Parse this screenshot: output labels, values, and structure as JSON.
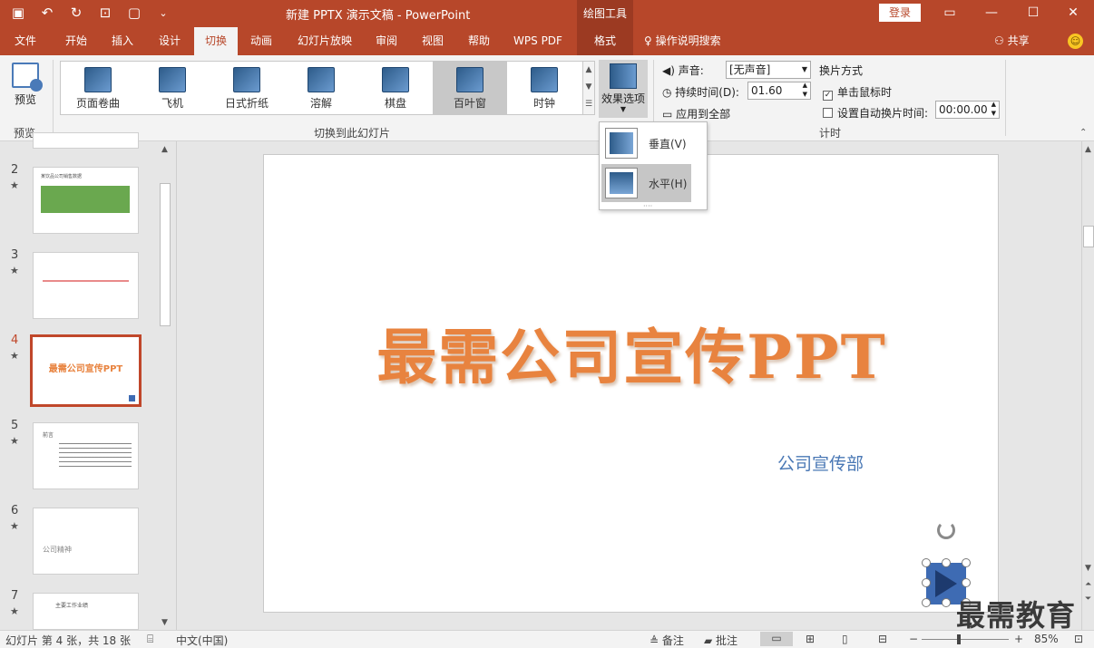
{
  "titlebar": {
    "title": "新建 PPTX 演示文稿  -  PowerPoint",
    "context_title": "绘图工具",
    "login": "登录"
  },
  "tabs": [
    "文件",
    "开始",
    "插入",
    "设计",
    "切换",
    "动画",
    "幻灯片放映",
    "审阅",
    "视图",
    "帮助",
    "WPS PDF",
    "格式"
  ],
  "tellme": "操作说明搜索",
  "share": "共享",
  "ribbon": {
    "preview_label": "预览",
    "preview_group": "预览",
    "transitions": [
      "页面卷曲",
      "飞机",
      "日式折纸",
      "溶解",
      "棋盘",
      "百叶窗",
      "时钟"
    ],
    "selected_transition": "百叶窗",
    "transitions_group": "切换到此幻灯片",
    "effect_options": "效果选项",
    "sound_label": "声音:",
    "sound_value": "[无声音]",
    "duration_label": "持续时间(D):",
    "duration_value": "01.60",
    "apply_all": "应用到全部",
    "advance_label": "换片方式",
    "on_click": "单击鼠标时",
    "after_time": "设置自动换片时间:",
    "after_time_value": "00:00.00",
    "timing_group": "计时"
  },
  "dropdown": {
    "items": [
      "垂直(V)",
      "水平(H)"
    ],
    "highlighted": "水平(H)"
  },
  "slides": [
    {
      "num": "2",
      "star": "★",
      "caption": "某饮品公司销售数据"
    },
    {
      "num": "3",
      "star": "★",
      "caption": ""
    },
    {
      "num": "4",
      "star": "★",
      "caption": "最需公司宣传PPT"
    },
    {
      "num": "5",
      "star": "★",
      "caption": "前言"
    },
    {
      "num": "6",
      "star": "★",
      "caption": "公司精神"
    },
    {
      "num": "7",
      "star": "★",
      "caption": "主要工作业绩"
    }
  ],
  "current_slide": "4",
  "slide": {
    "title": "最需公司宣传PPT",
    "subtitle": "公司宣传部"
  },
  "watermark": "最需教育",
  "status": {
    "slide_info": "幻灯片 第 4 张，共 18 张",
    "language": "中文(中国)",
    "notes": "备注",
    "comments": "批注",
    "zoom": "85%"
  },
  "colors": {
    "accent": "#b7472a",
    "title_orange": "#e8833f",
    "subtitle_blue": "#4a78b5"
  }
}
